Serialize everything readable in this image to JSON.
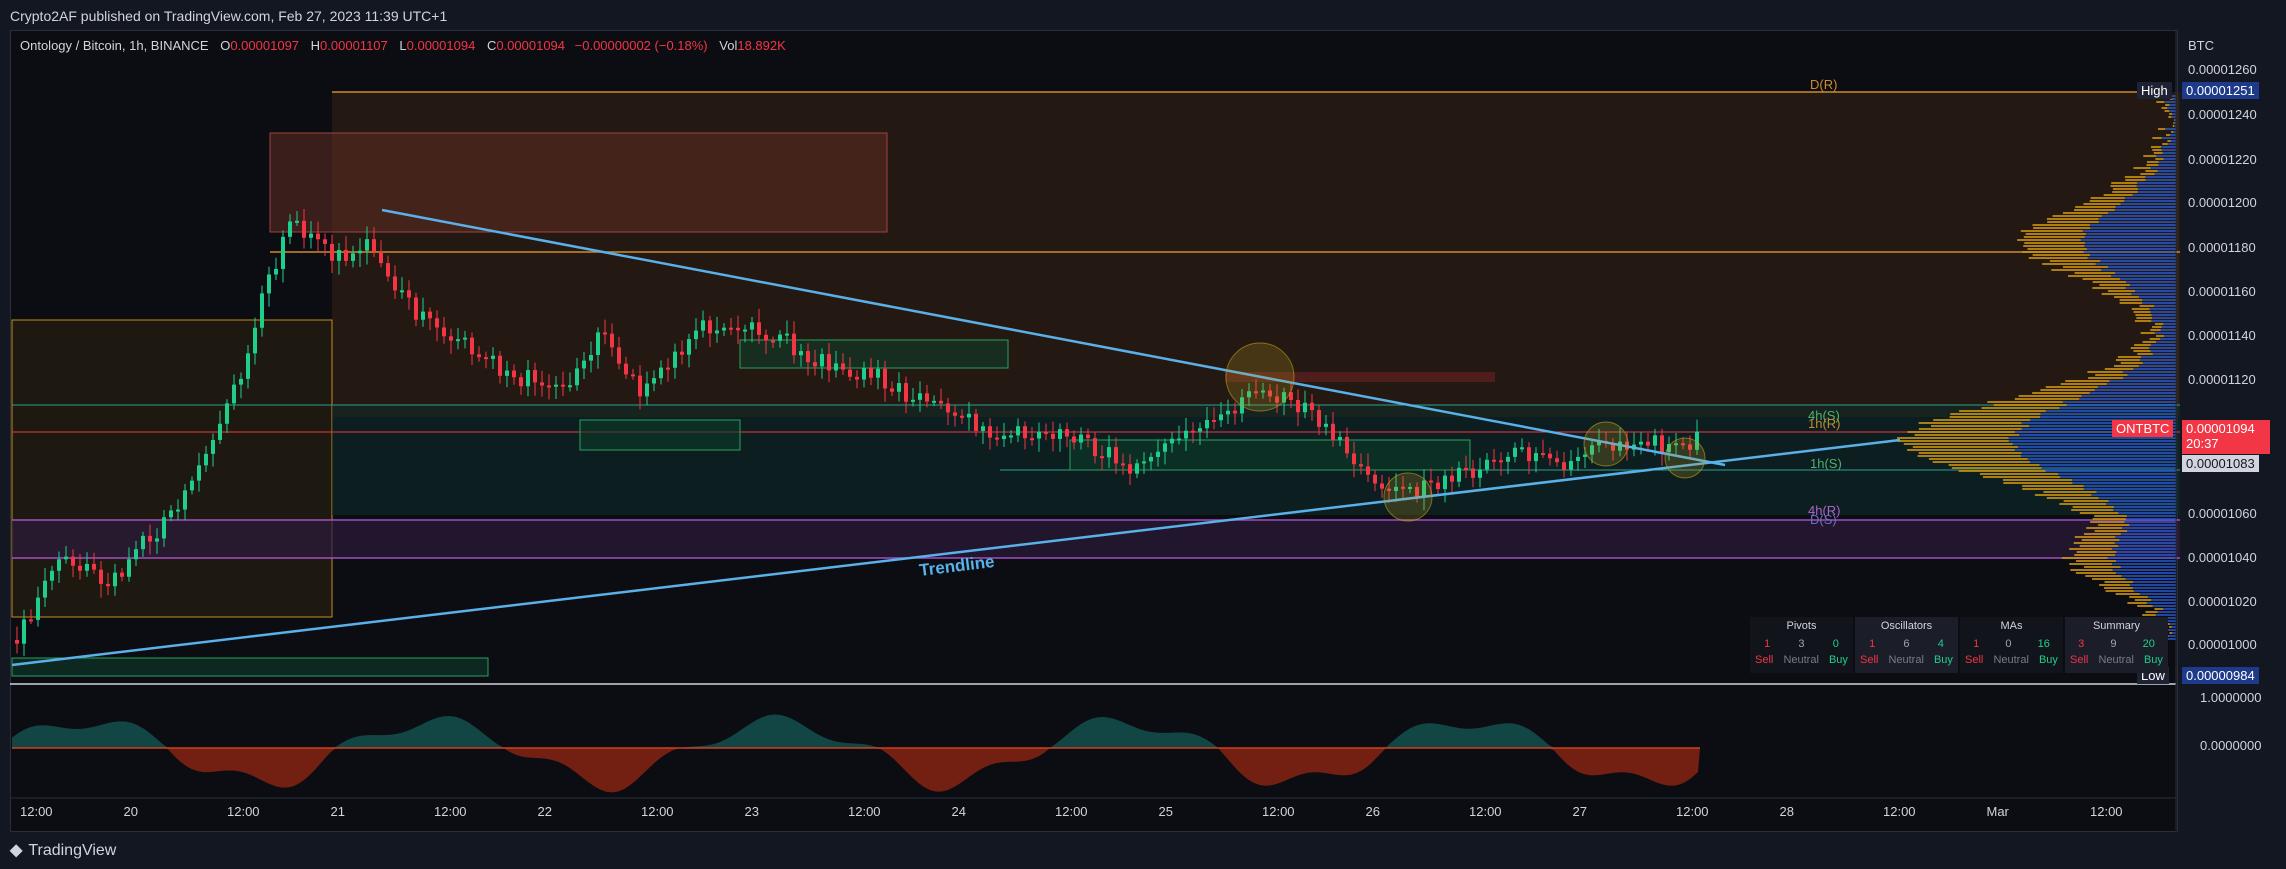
{
  "header": "Crypto2AF published on TradingView.com, Feb 27, 2023 11:39 UTC+1",
  "symbol_line": {
    "name": "Ontology / Bitcoin, 1h, BINANCE",
    "o_label": "O",
    "o": "0.00001097",
    "h_label": "H",
    "h": "0.00001107",
    "l_label": "L",
    "l": "0.00001094",
    "c_label": "C",
    "c": "0.00001094",
    "chg": "−0.00000002 (−0.18%)",
    "vol_label": "Vol",
    "vol": "18.892K"
  },
  "price_axis": {
    "currency": "BTC",
    "ticks": [
      "0.00001260",
      "0.00001240",
      "0.00001220",
      "0.00001200",
      "0.00001180",
      "0.00001160",
      "0.00001140",
      "0.00001120",
      "0.00001060",
      "0.00001040",
      "0.00001020",
      "0.00001000"
    ],
    "high_label": "High",
    "high_value": "0.00001251",
    "low_label": "Low",
    "low_value": "0.00000984",
    "symbol_tag": "ONTBTC",
    "last_price": "0.00001094",
    "countdown": "20:37",
    "level_value": "0.00001083"
  },
  "osc_axis": {
    "ticks": [
      "1.0000000",
      "0.0000000"
    ]
  },
  "time_axis": [
    "12:00",
    "20",
    "12:00",
    "21",
    "12:00",
    "22",
    "12:00",
    "23",
    "12:00",
    "24",
    "12:00",
    "25",
    "12:00",
    "26",
    "12:00",
    "27",
    "12:00",
    "28",
    "12:00",
    "Mar",
    "12:00"
  ],
  "annotations": {
    "trendline": "Trendline",
    "d_r": "D(R)",
    "h4_s": "4h(S)",
    "h1_r": "1h(R)",
    "h1_s": "1h(S)",
    "h4_r": "4h(R)",
    "d_s": "D(S)"
  },
  "technicals": {
    "groups": [
      {
        "title": "Pivots",
        "sell": "1",
        "neutral": "3",
        "buy": "0"
      },
      {
        "title": "Oscillators",
        "sell": "1",
        "neutral": "6",
        "buy": "4"
      },
      {
        "title": "MAs",
        "sell": "1",
        "neutral": "0",
        "buy": "16"
      },
      {
        "title": "Summary",
        "sell": "3",
        "neutral": "9",
        "buy": "20"
      }
    ],
    "sell_label": "Sell",
    "neutral_label": "Neutral",
    "buy_label": "Buy"
  },
  "footer_logo": "TradingView",
  "colors": {
    "up": "#089981",
    "down": "#f23645",
    "trend": "#5ab0e8",
    "bg": "#0b0d12"
  },
  "chart_data": {
    "type": "line",
    "title": "Ontology / Bitcoin, 1h, BINANCE",
    "ylabel": "BTC",
    "ylim": [
      9.8e-06,
      1.26e-05
    ],
    "series": [
      {
        "x": [
          "19 12:00",
          "20 12:00",
          "21 00:00",
          "21 12:00",
          "22 12:00",
          "23 12:00",
          "24 12:00",
          "25 12:00",
          "26 00:00",
          "26 12:00",
          "27 12:00"
        ],
        "values": [
          9.9e-06,
          1.04e-05,
          1.19e-05,
          1.16e-05,
          1.12e-05,
          1.15e-05,
          1.1e-05,
          1.12e-05,
          1.07e-05,
          1.09e-05,
          1.094e-05
        ]
      }
    ],
    "grid": false
  }
}
